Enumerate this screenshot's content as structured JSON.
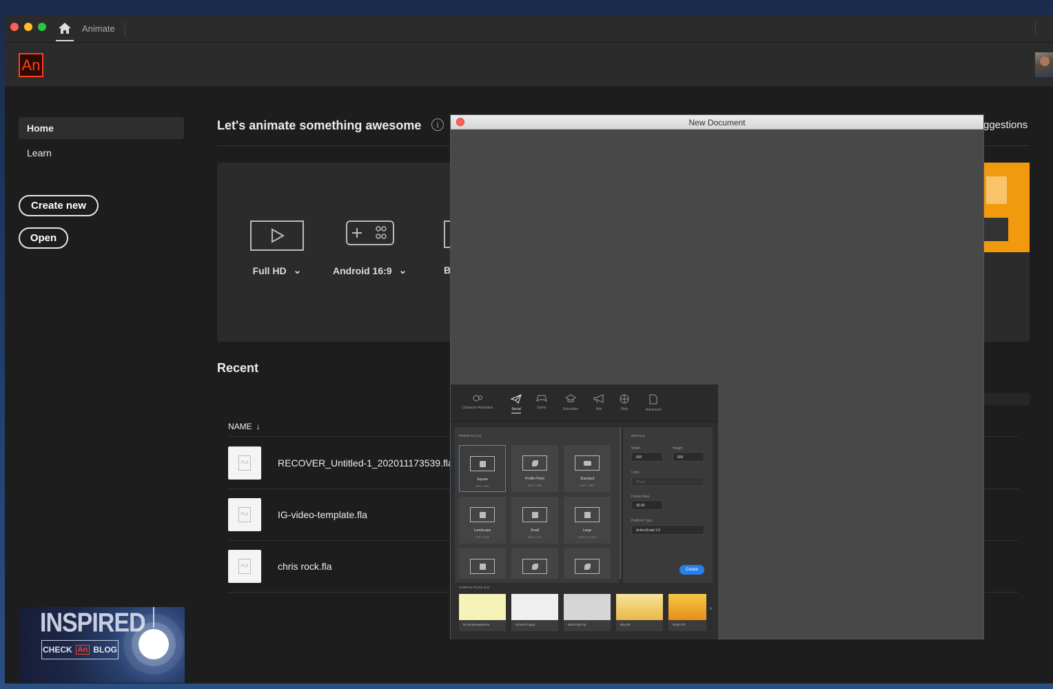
{
  "window": {
    "app_title": "Animate"
  },
  "header": {
    "logo_text": "An"
  },
  "sidebar": {
    "items": [
      {
        "label": "Home"
      },
      {
        "label": "Learn"
      }
    ],
    "create_new_label": "Create new",
    "open_label": "Open",
    "promo": {
      "line1": "INSPIRED",
      "check": "CHECK",
      "an": "An",
      "blog": "BLOG"
    }
  },
  "main": {
    "title": "Let's animate something awesome",
    "suggestions_label": "ggestions",
    "presets": [
      {
        "label": "Full HD",
        "icon": "video-play-icon"
      },
      {
        "label": "Android 16:9",
        "icon": "gamepad-icon"
      },
      {
        "label": "B",
        "icon": "device-icon"
      }
    ],
    "recent_title": "Recent",
    "column_name": "NAME",
    "files": [
      {
        "name": "RECOVER_Untitled-1_202011173539.fla",
        "type": "FLA"
      },
      {
        "name": "IG-video-template.fla",
        "type": "FLA"
      },
      {
        "name": "chris rock.fla",
        "type": "FLA"
      }
    ]
  },
  "dialog": {
    "title": "New Document",
    "categories": [
      {
        "label": "Character Animation",
        "icon": "character-icon"
      },
      {
        "label": "Social",
        "icon": "paper-plane-icon",
        "active": true
      },
      {
        "label": "Game",
        "icon": "gamepad-icon"
      },
      {
        "label": "Education",
        "icon": "graduation-cap-icon"
      },
      {
        "label": "Ads",
        "icon": "megaphone-icon"
      },
      {
        "label": "Web",
        "icon": "globe-icon"
      },
      {
        "label": "Advanced",
        "icon": "document-icon"
      }
    ],
    "presets_label": "PRESETS (12)",
    "presets": [
      {
        "name": "Square",
        "size": "600 x 600",
        "icon": "facebook-icon",
        "selected": true
      },
      {
        "name": "Profile Photo",
        "size": "400 x 400",
        "icon": "twitter-icon"
      },
      {
        "name": "Standard",
        "size": "640 x 480",
        "icon": "youtube-icon"
      },
      {
        "name": "Landscape",
        "size": "600 x 315",
        "icon": "facebook-icon"
      },
      {
        "name": "Small",
        "size": "256 x 144",
        "icon": "facebook-icon"
      },
      {
        "name": "Large",
        "size": "3,840 x 2,160",
        "icon": "facebook-icon"
      },
      {
        "name": "",
        "size": "",
        "icon": "facebook-icon"
      },
      {
        "name": "",
        "size": "",
        "icon": "twitter-icon"
      },
      {
        "name": "",
        "size": "",
        "icon": "twitter-icon"
      }
    ],
    "details": {
      "label": "DETAILS",
      "width_label": "Width",
      "width": "600",
      "height_label": "Height",
      "height": "600",
      "units_label": "Units",
      "units": "Pixels",
      "frame_rate_label": "Frame Rate",
      "frame_rate": "30.00",
      "platform_label": "Platform Type",
      "platform": "ActionScript 3.0",
      "create_label": "Create"
    },
    "samples_label": "SAMPLE FILES (14)",
    "samples": [
      {
        "name": "Mr McBoneyBones",
        "color": "#f6f3b8"
      },
      {
        "name": "Scared Puppy",
        "color": "#efefef"
      },
      {
        "name": "Bouncing Pig",
        "color": "#d6d6d6"
      },
      {
        "name": "Bicycle",
        "color": "#f2d27a"
      },
      {
        "name": "Ninja Girl",
        "color": "#f0b43c"
      }
    ]
  }
}
